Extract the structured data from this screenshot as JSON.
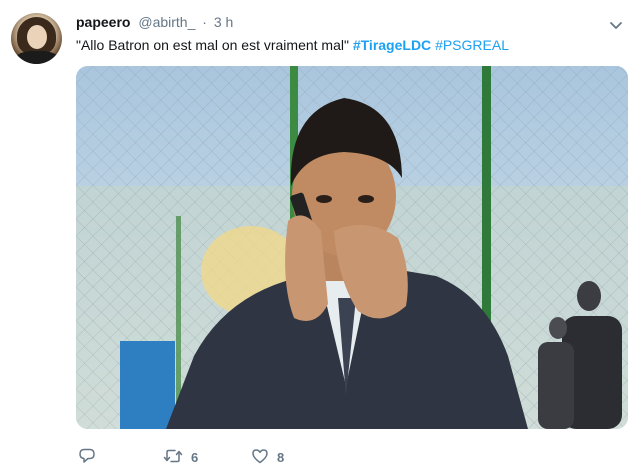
{
  "tweet": {
    "display_name": "papeero",
    "handle": "@abirth_",
    "separator": "·",
    "time": "3 h",
    "text_plain": "\"Allo Batron on est mal on est vraiment mal\"",
    "hashtags": [
      "#TirageLDC",
      "#PSGREAL"
    ],
    "retweet_count": "6",
    "like_count": "8"
  },
  "icons": {
    "avatar": "avatar",
    "caret": "chevron-down-icon",
    "reply": "reply-icon",
    "retweet": "retweet-icon",
    "like": "heart-icon"
  },
  "colors": {
    "link": "#1da1f2",
    "muted": "#657786"
  }
}
